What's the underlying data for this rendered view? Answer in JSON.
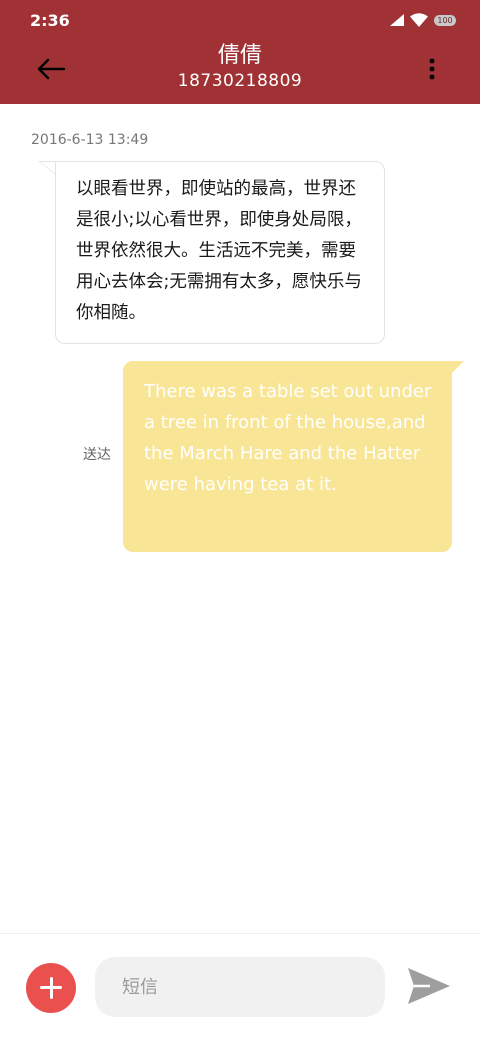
{
  "status_bar": {
    "time": "2:36",
    "battery": "100"
  },
  "header": {
    "contact_name": "倩倩",
    "phone_number": "18730218809",
    "background_color": "#a03236",
    "back_icon": "arrow-left-icon",
    "menu_icon": "more-vertical-icon"
  },
  "conversation": {
    "timestamp": "2016-6-13 13:49",
    "messages": [
      {
        "direction": "incoming",
        "text": "以眼看世界，即使站的最高，世界还是很小;以心看世界，即使身处局限，世界依然很大。生活远不完美，需要用心去体会;无需拥有太多，愿快乐与你相随。"
      },
      {
        "direction": "outgoing",
        "text": "There was a table set out under a tree in front of the house,and the March Hare and the Hatter were having tea at it.",
        "status": "送达",
        "bubble_color": "#f8e596"
      }
    ]
  },
  "composer": {
    "placeholder": "短信",
    "value": "",
    "add_icon": "plus-icon",
    "send_icon": "send-icon",
    "accent_color": "#e9504e"
  }
}
